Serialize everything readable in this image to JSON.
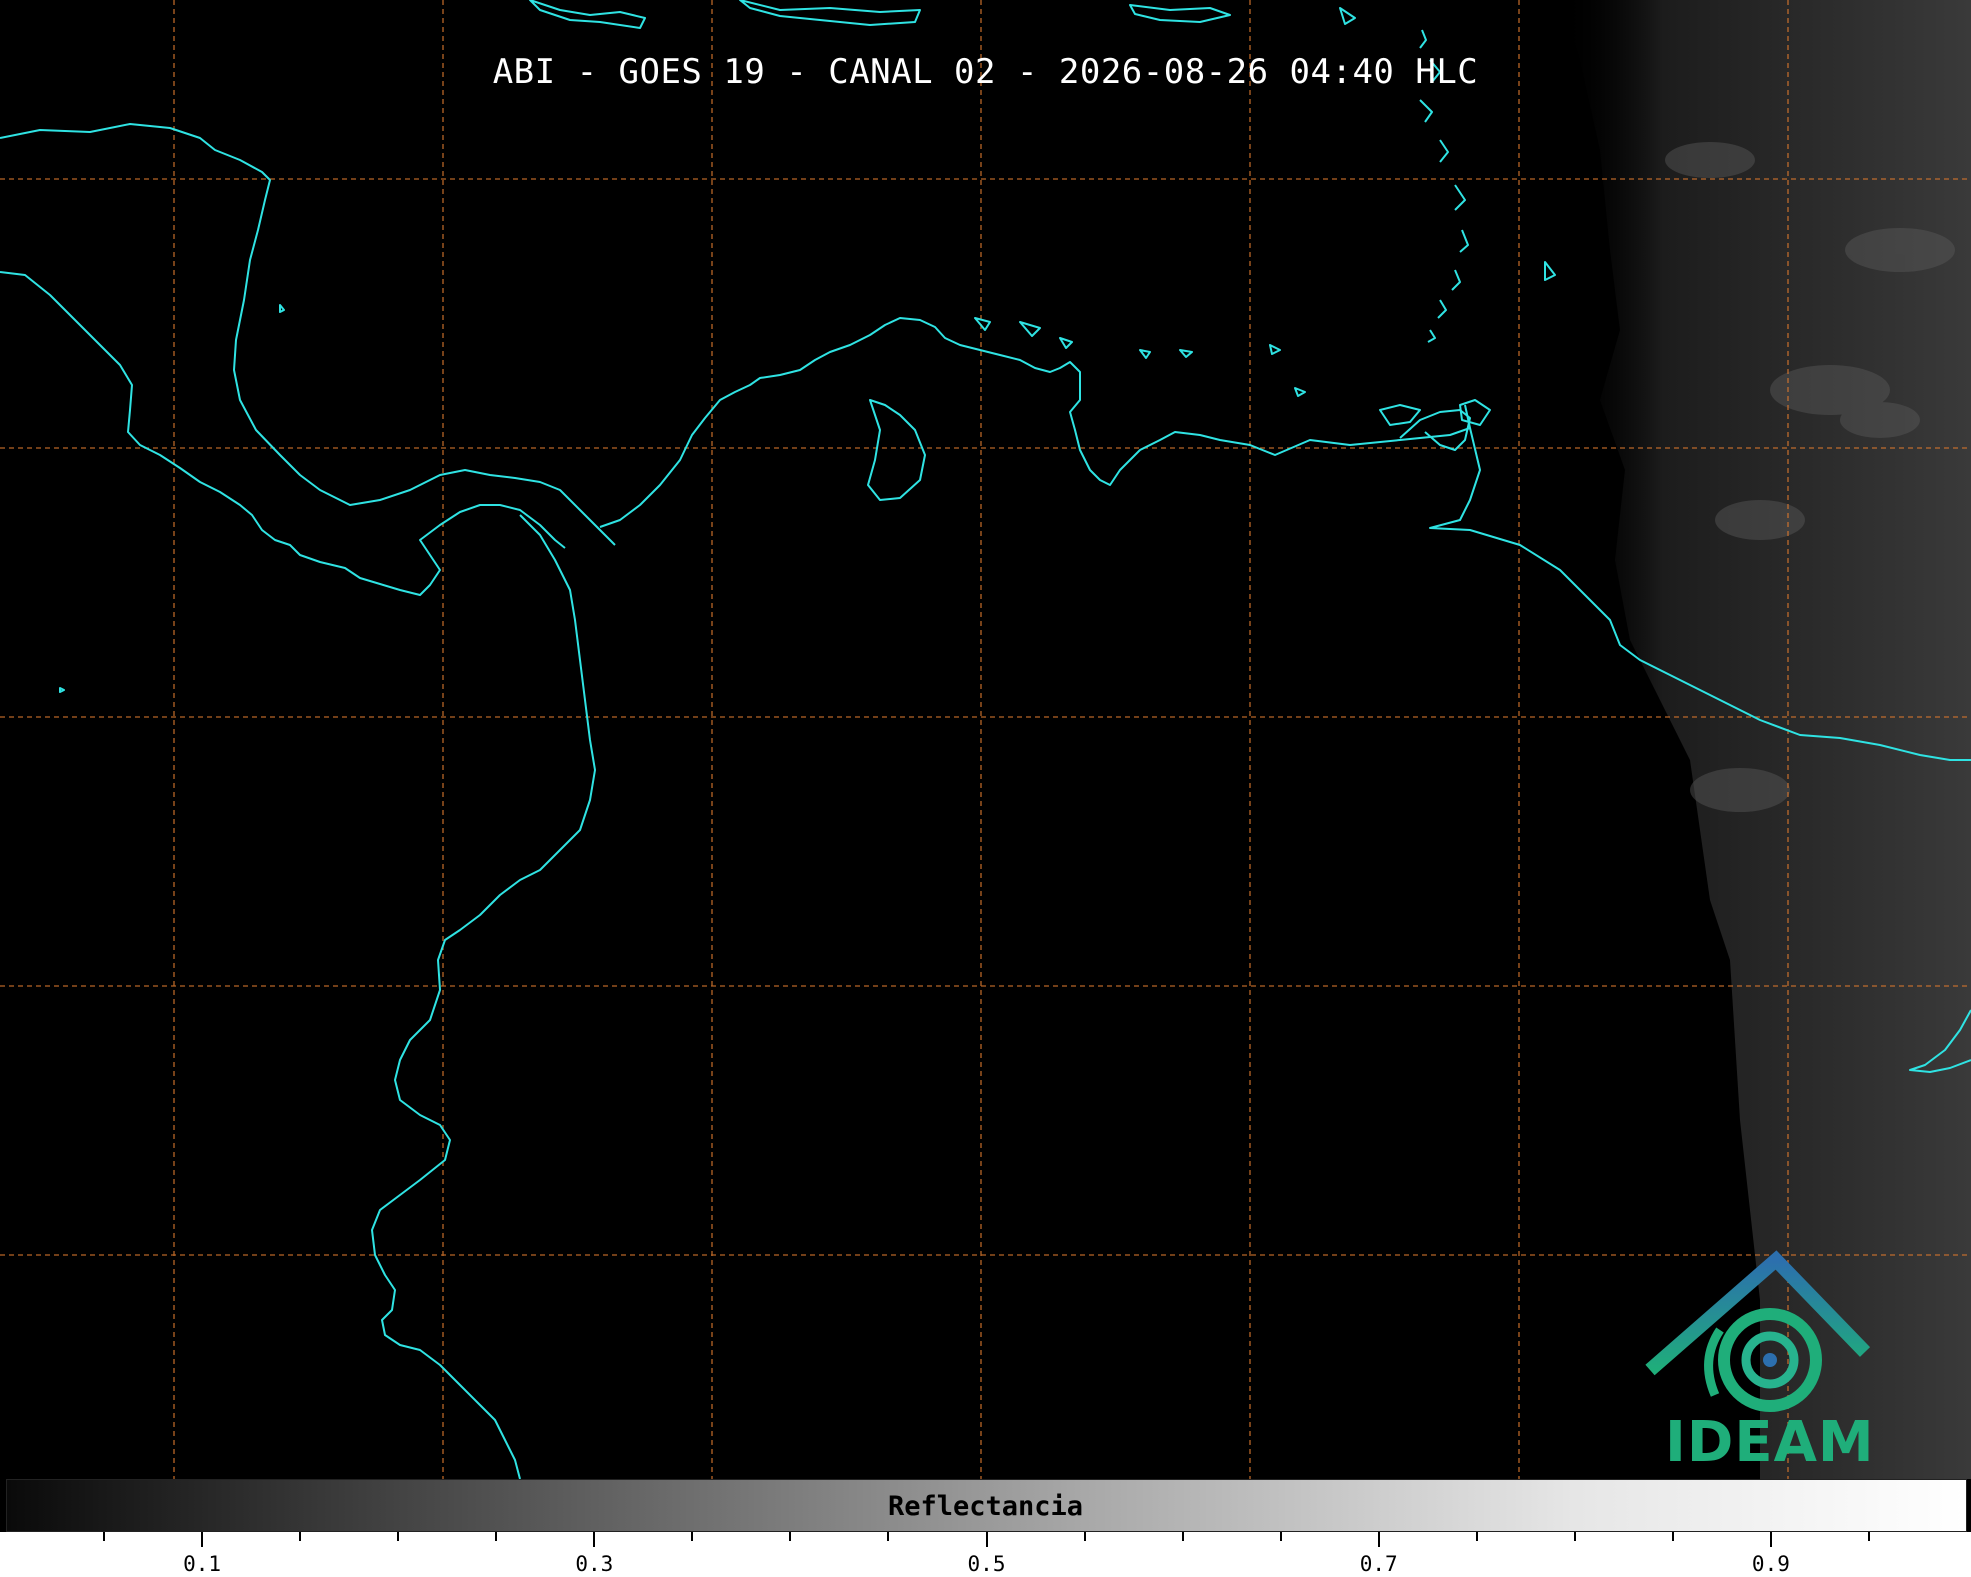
{
  "title": "ABI - GOES 19 - CANAL 02 - 2026-08-26 04:40 HLC",
  "logo": {
    "text": "IDEAM",
    "icon": "ideam-logo-icon"
  },
  "colorbar": {
    "label": "Reflectancia",
    "ticks": [
      {
        "value": 0.1,
        "label": "0.1"
      },
      {
        "value": 0.3,
        "label": "0.3"
      },
      {
        "value": 0.5,
        "label": "0.5"
      },
      {
        "value": 0.7,
        "label": "0.7"
      },
      {
        "value": 0.9,
        "label": "0.9"
      }
    ]
  },
  "colors": {
    "coastline": "#2fe3e3",
    "gridline": "#d8772e",
    "background": "#000000",
    "logo_green": "#1fae7a",
    "logo_blue": "#2c6fae"
  }
}
